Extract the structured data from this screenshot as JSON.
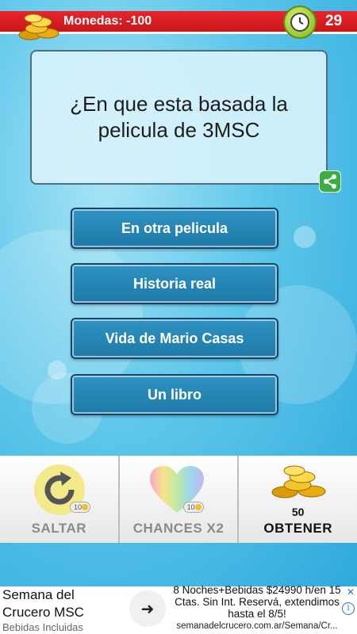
{
  "header": {
    "coins_label": "Monedas: -100",
    "timer": "29",
    "icons": [
      "coins-icon",
      "clock-icon"
    ]
  },
  "question": {
    "text": "¿En que esta basada la pelicula de 3MSC",
    "share_icon": "share-icon"
  },
  "answers": [
    {
      "label": "En otra pelicula"
    },
    {
      "label": "Historia real"
    },
    {
      "label": "Vida de Mario Casas"
    },
    {
      "label": "Un libro"
    }
  ],
  "powerups": {
    "skip": {
      "label": "SALTAR",
      "cost": "10",
      "icon": "refresh-icon"
    },
    "chances": {
      "label": "CHANCES X2",
      "cost": "10",
      "icon": "heart-icon"
    },
    "obtain": {
      "label": "OBTENER",
      "count": "50",
      "icon": "coins-icon"
    }
  },
  "ad": {
    "title": "Semana del Crucero MSC",
    "subtitle": "Bebidas Incluidas",
    "body": "8 Noches+Bebidas $24990 h/en 15 Ctas. Sin Int. Reservá, extendimos hasta el 8/5!",
    "url": "semanadelcrucero.com.ar/Semana/Cr...",
    "close": "✕",
    "info": "i",
    "arrow": "➜"
  },
  "colors": {
    "topbar": "#e8252a",
    "answer_button": "#2586b5",
    "background": "#5cc6ea",
    "share": "#3cae3f"
  }
}
